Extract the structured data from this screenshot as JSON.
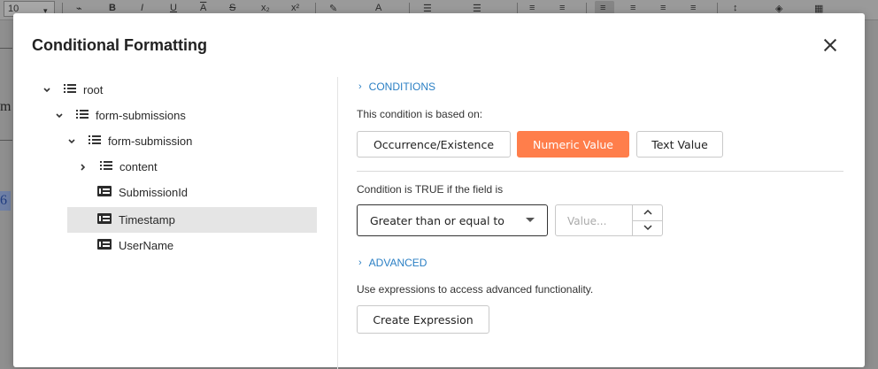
{
  "toolbar": {
    "font_size": "10",
    "icons": [
      "paint-format-icon",
      "bold-icon",
      "italic-icon",
      "underline-icon",
      "overline-icon",
      "strikethrough-icon",
      "subscript-icon",
      "superscript-icon",
      "highlight-icon",
      "font-color-icon",
      "bullet-list-icon",
      "numbered-list-icon",
      "outdent-icon",
      "indent-icon",
      "align-left-icon",
      "align-center-icon",
      "align-right-icon",
      "justify-icon",
      "line-spacing-icon",
      "fill-color-icon",
      "borders-icon"
    ],
    "glyphs": {
      "bold": "B",
      "italic": "I",
      "underline": "U",
      "overline": "A",
      "strike": "S",
      "sub": "x₂",
      "sup": "x²",
      "fontcolor": "A"
    }
  },
  "background": {
    "left_fragment_1": "m",
    "left_fragment_2": "6"
  },
  "dialog": {
    "title": "Conditional Formatting",
    "tree": [
      {
        "label": "root",
        "type": "list",
        "expanded": true
      },
      {
        "label": "form-submissions",
        "type": "list",
        "expanded": true
      },
      {
        "label": "form-submission",
        "type": "list",
        "expanded": true
      },
      {
        "label": "content",
        "type": "list",
        "expanded": false
      },
      {
        "label": "SubmissionId",
        "type": "field"
      },
      {
        "label": "Timestamp",
        "type": "field",
        "selected": true
      },
      {
        "label": "UserName",
        "type": "field"
      }
    ],
    "conditions": {
      "header": "CONDITIONS",
      "based_on_text": "This condition is based on:",
      "types": [
        "Occurrence/Existence",
        "Numeric Value",
        "Text Value"
      ],
      "active_type": "Numeric Value",
      "true_if_text": "Condition is TRUE if the field is",
      "operator": "Greater than or equal to",
      "value_placeholder": "Value..."
    },
    "advanced": {
      "header": "ADVANCED",
      "description": "Use expressions to access advanced functionality.",
      "button": "Create Expression"
    }
  },
  "colors": {
    "accent": "#ff7e4b",
    "link": "#2a7fc4",
    "selected_row": "#e5e5e5"
  }
}
